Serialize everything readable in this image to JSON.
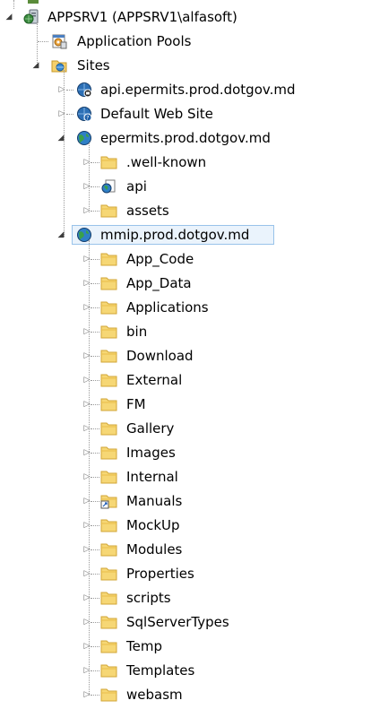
{
  "tree": {
    "server": {
      "label": "APPSRV1 (APPSRV1\\alfasoft)",
      "icon": "server-icon"
    },
    "app_pools": {
      "label": "Application Pools",
      "icon": "application-pools-icon"
    },
    "sites": {
      "label": "Sites",
      "icon": "sites-folder-icon"
    },
    "site_api": {
      "label": "api.epermits.prod.dotgov.md",
      "icon": "globe-stopped-icon"
    },
    "site_default": {
      "label": "Default Web Site",
      "icon": "globe-help-icon"
    },
    "site_epermits": {
      "label": "epermits.prod.dotgov.md",
      "icon": "globe-icon",
      "children": [
        {
          "label": ".well-known",
          "icon": "folder-icon"
        },
        {
          "label": "api",
          "icon": "application-icon"
        },
        {
          "label": "assets",
          "icon": "folder-icon"
        }
      ]
    },
    "site_mmip": {
      "label": "mmip.prod.dotgov.md",
      "icon": "globe-icon",
      "selected": true,
      "children": [
        {
          "label": "App_Code",
          "icon": "folder-icon"
        },
        {
          "label": "App_Data",
          "icon": "folder-icon"
        },
        {
          "label": "Applications",
          "icon": "folder-icon"
        },
        {
          "label": "bin",
          "icon": "folder-icon"
        },
        {
          "label": "Download",
          "icon": "folder-icon"
        },
        {
          "label": "External",
          "icon": "folder-icon"
        },
        {
          "label": "FM",
          "icon": "folder-icon"
        },
        {
          "label": "Gallery",
          "icon": "folder-icon"
        },
        {
          "label": "Images",
          "icon": "folder-icon"
        },
        {
          "label": "Internal",
          "icon": "folder-icon"
        },
        {
          "label": "Manuals",
          "icon": "folder-shortcut-icon"
        },
        {
          "label": "MockUp",
          "icon": "folder-icon"
        },
        {
          "label": "Modules",
          "icon": "folder-icon"
        },
        {
          "label": "Properties",
          "icon": "folder-icon"
        },
        {
          "label": "scripts",
          "icon": "folder-icon"
        },
        {
          "label": "SqlServerTypes",
          "icon": "folder-icon"
        },
        {
          "label": "Temp",
          "icon": "folder-icon"
        },
        {
          "label": "Templates",
          "icon": "folder-icon"
        },
        {
          "label": "webasm",
          "icon": "folder-icon"
        }
      ]
    }
  },
  "colors": {
    "selection_bg": "#eaf3fc",
    "selection_border": "#99c3ea",
    "folder": "#f5d06c"
  }
}
